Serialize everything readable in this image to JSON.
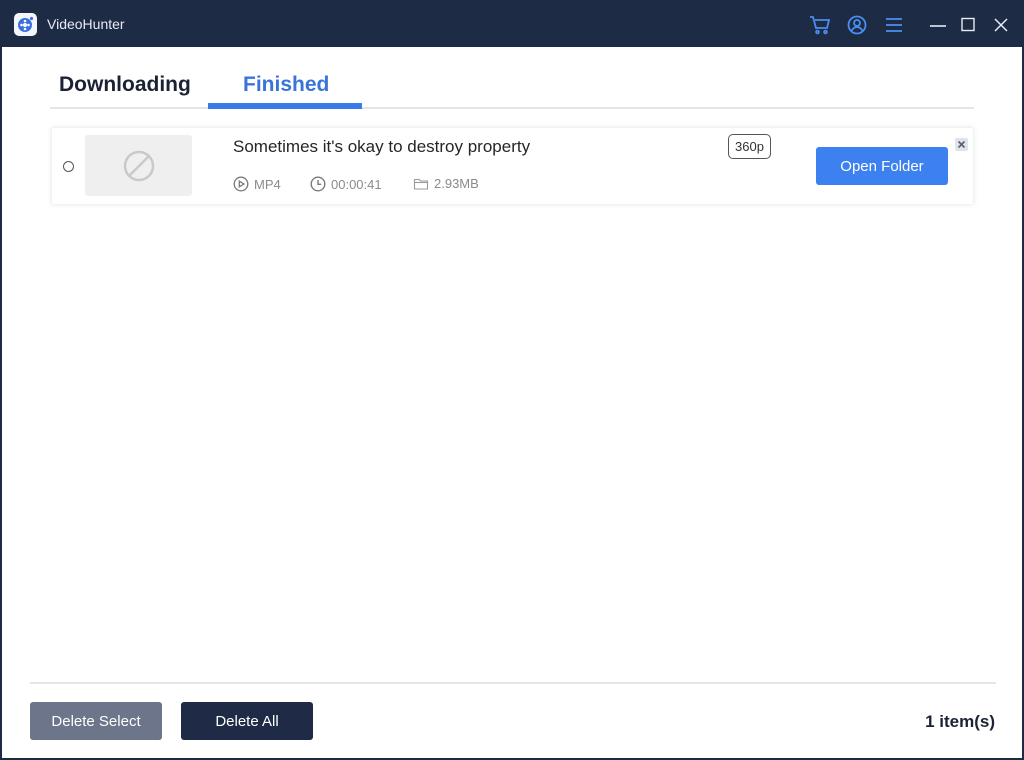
{
  "titlebar": {
    "app_title": "VideoHunter",
    "icons": [
      "app-logo-icon",
      "cart-icon",
      "account-icon",
      "menu-icon",
      "minimize-icon",
      "maximize-icon",
      "close-icon"
    ]
  },
  "tabs": [
    {
      "label": "Downloading",
      "active": false
    },
    {
      "label": "Finished",
      "active": true
    }
  ],
  "items": [
    {
      "title": "Sometimes it's okay to destroy property",
      "format": "MP4",
      "duration": "00:00:41",
      "size": "2.93MB",
      "quality": "360p",
      "action_label": "Open Folder",
      "thumbnail": "unavailable-icon",
      "selected": false
    }
  ],
  "footer": {
    "delete_select_label": "Delete Select",
    "delete_all_label": "Delete All",
    "item_count": "1 item(s)"
  },
  "colors": {
    "titlebar": "#1e2b45",
    "accent": "#3d80f0",
    "active_tab": "#3a74d9",
    "delete_select": "#6c7589",
    "delete_all": "#1f2b46"
  }
}
